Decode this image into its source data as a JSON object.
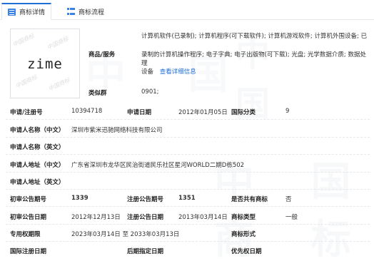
{
  "tabs": [
    {
      "label": "商标详情",
      "icon": "document-icon",
      "active": true
    },
    {
      "label": "商标流程",
      "icon": "flow-icon",
      "active": false
    }
  ],
  "logo": {
    "text": "zime",
    "seal_text": "中国商标"
  },
  "goods_services": {
    "label": "商品/服务",
    "line1": "计算机软件(已录制); 计算机程序(可下载软件); 计算机游戏软件; 计算机外围设备; 已",
    "line2": "录制的计算机操作程序; 电子字典; 电子出版物(可下载); 光盘; 光学数据介质; 数据处理",
    "line3": "设备",
    "detail_link": "查看详细信息"
  },
  "similar_group": {
    "label": "类似群",
    "value": "0901;"
  },
  "fields": {
    "app_no_label": "申请/注册号",
    "app_no": "10394718",
    "app_date_label": "申请日期",
    "app_date": "2012年01月05日",
    "intl_class_label": "国际分类",
    "intl_class": "9",
    "applicant_cn_label": "申请人名称（中文）",
    "applicant_cn": "深圳市紫米迅驰网络科技有限公司",
    "applicant_en_label": "申请人名称（英文）",
    "applicant_en": "",
    "address_cn_label": "申请人地址（中文）",
    "address_cn": "广东省深圳市龙华区民治街道民乐社区星河WORLD二期D栋502",
    "address_en_label": "申请人地址（英文）",
    "address_en": "",
    "prelim_pub_no_label": "初审公告期号",
    "prelim_pub_no": "1339",
    "reg_pub_no_label": "注册公告期号",
    "reg_pub_no": "1351",
    "common_label": "是否共有商标",
    "common": "否",
    "prelim_pub_date_label": "初审公告日期",
    "prelim_pub_date": "2012年12月13日",
    "reg_pub_date_label": "注册公告日期",
    "reg_pub_date": "2013年03月14日",
    "tm_type_label": "商标类型",
    "tm_type": "一般",
    "exclusive_label": "专用权期限",
    "exclusive": "2023年03月14日 至 2033年03月13日",
    "tm_form_label": "商标形式",
    "tm_form": "",
    "intl_reg_date_label": "国际注册日期",
    "intl_reg_date": "",
    "later_date_label": "后期指定日期",
    "later_date": "",
    "priority_date_label": "优先权日期",
    "priority_date": ""
  },
  "watermark": {
    "text": "中国商标"
  },
  "colors": {
    "accent": "#1e6fd9",
    "link": "#1e6fd9",
    "border": "#e3e6ea"
  }
}
